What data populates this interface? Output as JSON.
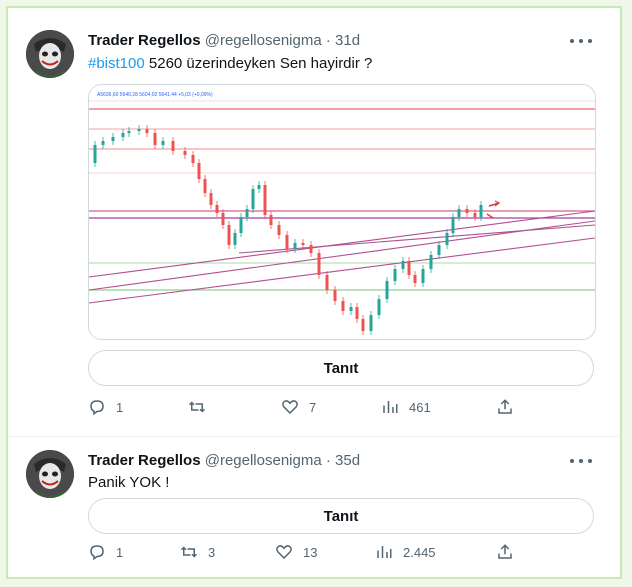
{
  "tweets": [
    {
      "name": "Trader Regellos",
      "handle": "@regellosenigma",
      "dot": "·",
      "time": "31d",
      "hashtag": "#bist100",
      "text": " 5260 üzerindeyken Sen hayirdir ?",
      "button_label": "Tanıt",
      "replies": "1",
      "retweets": "",
      "likes": "7",
      "views": "461",
      "chart_header": "A5636,60 5640,28 5604,02 5641,44 +5,03 (+0,09%)"
    },
    {
      "name": "Trader Regellos",
      "handle": "@regellosenigma",
      "dot": "·",
      "time": "35d",
      "text": "Panik YOK !",
      "button_label": "Tanıt",
      "replies": "1",
      "retweets": "3",
      "likes": "13",
      "views": "2.445"
    }
  ],
  "icons": {
    "avatar": "joker-avatar",
    "more": "more-dots-icon",
    "reply": "reply-icon",
    "retweet": "retweet-icon",
    "like": "heart-icon",
    "views": "views-bar-chart-icon",
    "share": "share-icon"
  },
  "colors": {
    "hashtag": "#1d9bf0",
    "muted": "#536471",
    "border": "#cfd9de",
    "frame_border": "#c9e8b8"
  }
}
